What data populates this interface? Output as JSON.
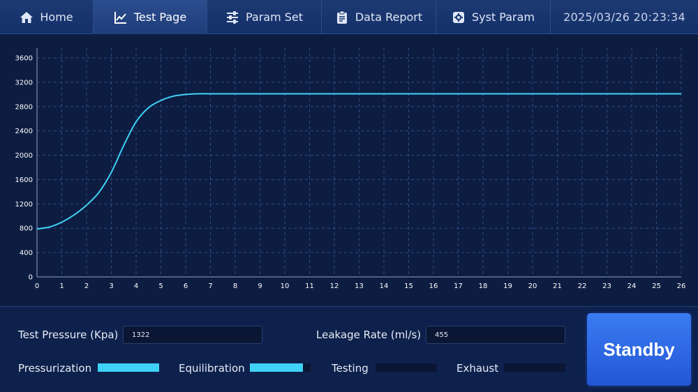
{
  "nav": {
    "tabs": [
      {
        "label": "Home",
        "icon": "home-icon"
      },
      {
        "label": "Test Page",
        "icon": "line-chart-icon"
      },
      {
        "label": "Param Set",
        "icon": "sliders-icon"
      },
      {
        "label": "Data Report",
        "icon": "clipboard-icon"
      },
      {
        "label": "Syst Param",
        "icon": "gear-icon"
      }
    ],
    "active_tab": "Test Page",
    "datetime": "2025/03/26 20:23:34"
  },
  "chart_data": {
    "type": "line",
    "title": "",
    "xlabel": "",
    "ylabel": "",
    "xlim": [
      0,
      26
    ],
    "ylim": [
      0,
      3600
    ],
    "x_ticks": [
      0,
      1,
      2,
      3,
      4,
      5,
      6,
      7,
      8,
      9,
      10,
      11,
      12,
      13,
      14,
      15,
      16,
      17,
      18,
      19,
      20,
      21,
      22,
      23,
      24,
      25,
      26
    ],
    "y_ticks": [
      0,
      400,
      800,
      1200,
      1600,
      2000,
      2400,
      2800,
      3200,
      3600
    ],
    "grid": true,
    "line_color": "#3fd2f7",
    "series": [
      {
        "x": [
          0,
          0.5,
          1,
          1.5,
          2,
          2.5,
          3,
          3.5,
          4,
          4.5,
          5,
          5.5,
          6,
          6.5,
          7,
          8,
          10,
          12,
          14,
          16,
          18,
          20,
          22,
          24,
          26
        ],
        "y": [
          790,
          820,
          900,
          1020,
          1180,
          1390,
          1720,
          2160,
          2550,
          2780,
          2900,
          2970,
          3000,
          3010,
          3010,
          3010,
          3010,
          3010,
          3010,
          3010,
          3010,
          3010,
          3010,
          3010,
          3010
        ]
      }
    ]
  },
  "panel": {
    "test_pressure_label": "Test Pressure (Kpa)",
    "test_pressure_value": "1322",
    "leakage_rate_label": "Leakage Rate (ml/s)",
    "leakage_rate_value": "455",
    "stages": [
      {
        "label": "Pressurization",
        "progress": 1.0
      },
      {
        "label": "Equilibration",
        "progress": 0.87
      },
      {
        "label": "Testing",
        "progress": 0
      },
      {
        "label": "Exhaust",
        "progress": 0
      }
    ],
    "standby_label": "Standby"
  }
}
